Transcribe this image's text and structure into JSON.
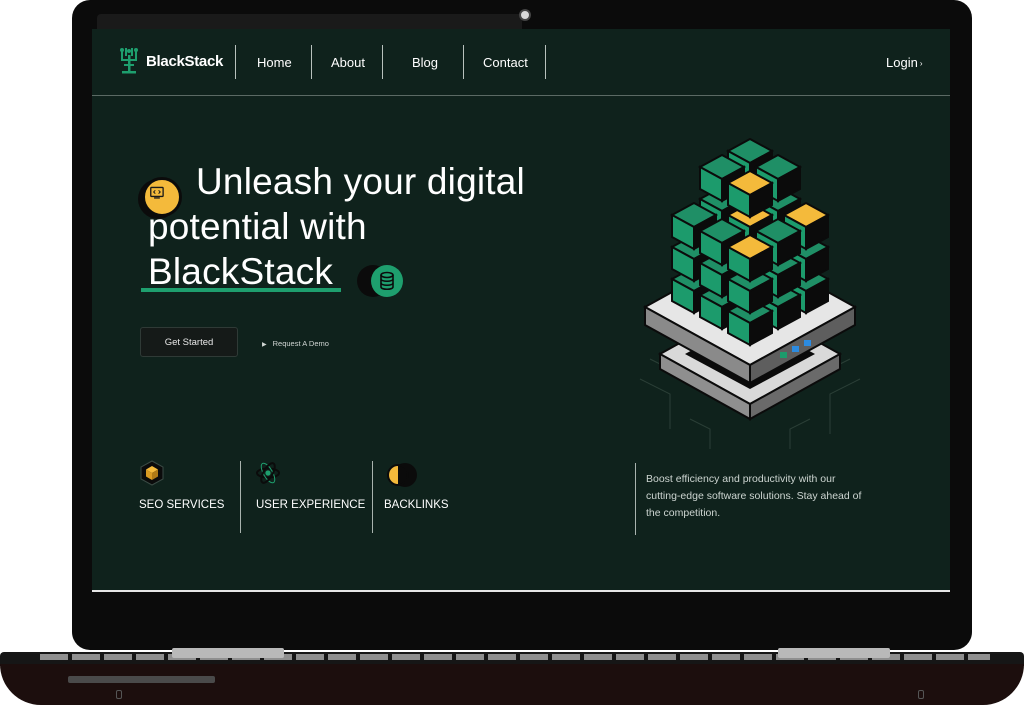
{
  "brand": {
    "name": "BlackStack"
  },
  "nav": {
    "links": [
      "Home",
      "About",
      "Blog",
      "Contact"
    ],
    "login_label": "Login",
    "login_caret": "›"
  },
  "hero": {
    "title_line1": "Unleash your digital",
    "title_line2": "potential with",
    "title_line3": "BlackStack",
    "cta_primary": "Get Started",
    "cta_secondary": "Request A Demo"
  },
  "features": [
    {
      "label": "SEO SERVICES",
      "icon": "cube-icon"
    },
    {
      "label": "USER EXPERIENCE",
      "icon": "atom-icon"
    },
    {
      "label": "BACKLINKS",
      "icon": "half-circle-icon"
    }
  ],
  "description": "Boost efficiency and productivity with our cutting-edge software solutions. Stay ahead of the competition.",
  "colors": {
    "background": "#0f221c",
    "accent_green": "#1e9f6e",
    "accent_yellow": "#f4ba3b",
    "text": "#ffffff"
  }
}
